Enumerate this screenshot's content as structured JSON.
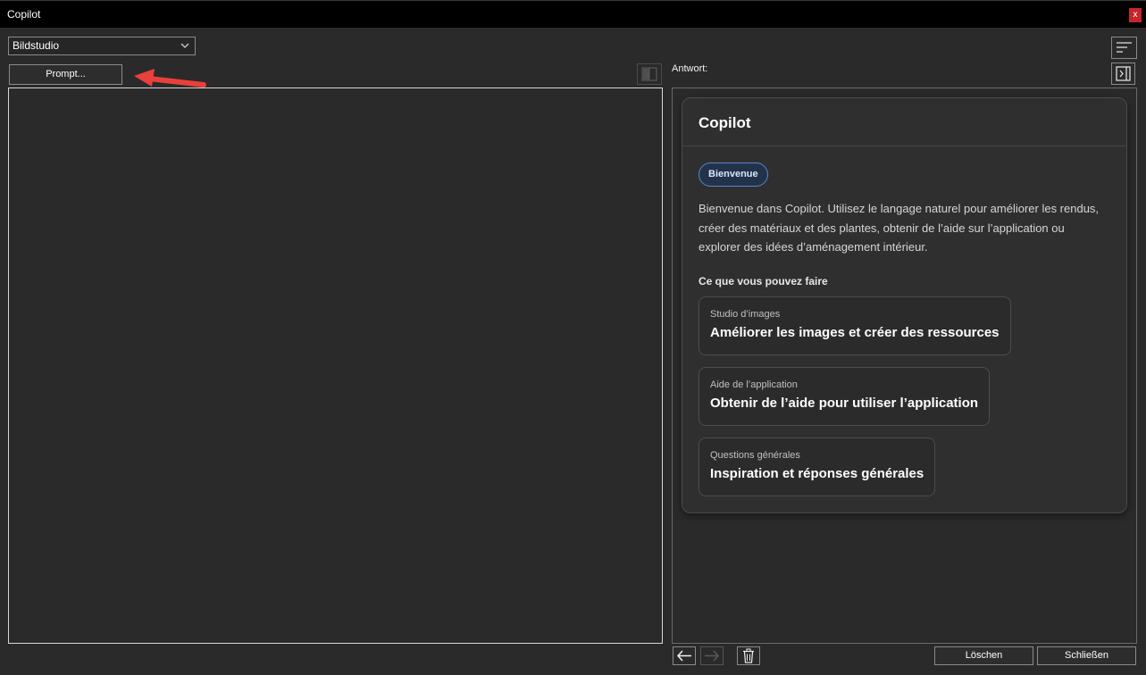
{
  "window": {
    "title": "Copilot",
    "close_label": "x"
  },
  "toolbar": {
    "mode_select_value": "Bildstudio",
    "prompt_button": "Prompt...",
    "answer_label": "Antwort:"
  },
  "card": {
    "title": "Copilot",
    "badge": "Bienvenue",
    "intro": "Bienvenue dans Copilot. Utilisez le langage naturel pour améliorer les rendus, créer des matériaux et des plantes, obtenir de l’aide sur l’application ou explorer des idées d’aménagement intérieur.",
    "section_heading": "Ce que vous pouvez faire",
    "options": [
      {
        "category": "Studio d’images",
        "action": "Améliorer les images et créer des ressources"
      },
      {
        "category": "Aide de l’application",
        "action": "Obtenir de l’aide pour utiliser l’application"
      },
      {
        "category": "Questions générales",
        "action": "Inspiration et réponses générales"
      }
    ]
  },
  "footer": {
    "delete_button": "Löschen",
    "close_button": "Schließen"
  },
  "icons": {
    "close": "close-icon",
    "dropdown": "chevron-down-icon",
    "arrow_annotation": "red-arrow-icon",
    "split_view": "split-view-icon",
    "menu": "filter-lines-icon",
    "collapse": "collapse-panel-icon",
    "back": "arrow-left-icon",
    "forward": "arrow-right-icon",
    "trash": "trash-icon"
  },
  "colors": {
    "accent_badge": "#5a86c8",
    "close_red": "#c4262b",
    "annotation_red": "#e8403c"
  }
}
